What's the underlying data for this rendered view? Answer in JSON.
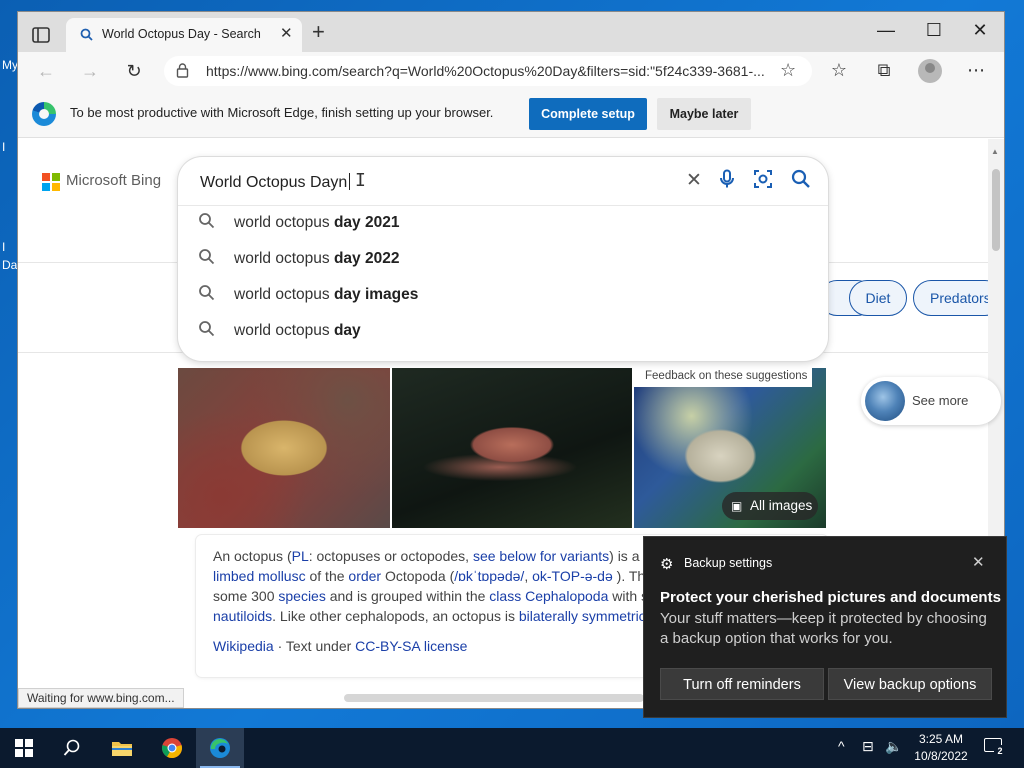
{
  "desktop": {
    "fragments": [
      "My",
      "I",
      "I",
      "Da"
    ]
  },
  "browser": {
    "tab_title": "World Octopus Day - Search",
    "url": "https://www.bing.com/search?q=World%20Octopus%20Day&filters=sid:\"5f24c339-3681-...",
    "new_tab": "+",
    "minimize": "—",
    "maximize": "☐",
    "close": "✕"
  },
  "infobar": {
    "message": "To be most productive with Microsoft Edge, finish setting up your browser.",
    "primary_button": "Complete setup",
    "secondary_button": "Maybe later"
  },
  "bing": {
    "logo_text": "Microsoft Bing",
    "query": "World Octopus Dayn",
    "suggestions": [
      {
        "prefix": "world octopus ",
        "bold": "day 2021"
      },
      {
        "prefix": "world octopus ",
        "bold": "day 2022"
      },
      {
        "prefix": "world octopus ",
        "bold": "day images"
      },
      {
        "prefix": "world octopus ",
        "bold": "day"
      }
    ],
    "feedback": "Feedback on these suggestions",
    "pills": [
      "Diet",
      "Predators"
    ],
    "all_images": "All images",
    "see_more": "See more"
  },
  "card": {
    "line1_a": "An octopus (",
    "line1_link1": "PL",
    "line1_b": ": octopuses or octopodes, ",
    "line1_link2": "see below for variants",
    "line1_c": ") is a",
    "line2_link1": "limbed mollusc",
    "line2_a": " of the ",
    "line2_link2": "order",
    "line2_b": " Octopoda (",
    "line2_link3": "/ɒkˈtɒpədə/",
    "line2_c": ", ",
    "line2_link4": "ok-TOP-ə-də",
    "line2_d": " ). Th",
    "line3_a": "some 300 ",
    "line3_link1": "species",
    "line3_b": " and is grouped within the ",
    "line3_link2": "class Cephalopoda",
    "line3_c": " with s",
    "line4_link1": "nautiloids",
    "line4_a": ". Like other cephalopods, an octopus is ",
    "line4_link2": "bilaterally symmetric",
    "source_link": "Wikipedia",
    "source_sep": " · Text under ",
    "license_link": "CC-BY-SA license"
  },
  "status": "Waiting for www.bing.com...",
  "toast": {
    "app_name": "Backup settings",
    "title": "Protect your cherished pictures and documents",
    "body": "Your stuff matters—keep it protected by choosing a backup option that works for you.",
    "button1": "Turn off reminders",
    "button2": "View backup options"
  },
  "taskbar": {
    "time": "3:25 AM",
    "date": "10/8/2022",
    "notification_count": "2"
  },
  "colors": {
    "accent": "#0f6cbd",
    "link": "#1a3fa8",
    "bing_blue": "#1a5fb4",
    "taskbar": "#0b1a2e"
  }
}
